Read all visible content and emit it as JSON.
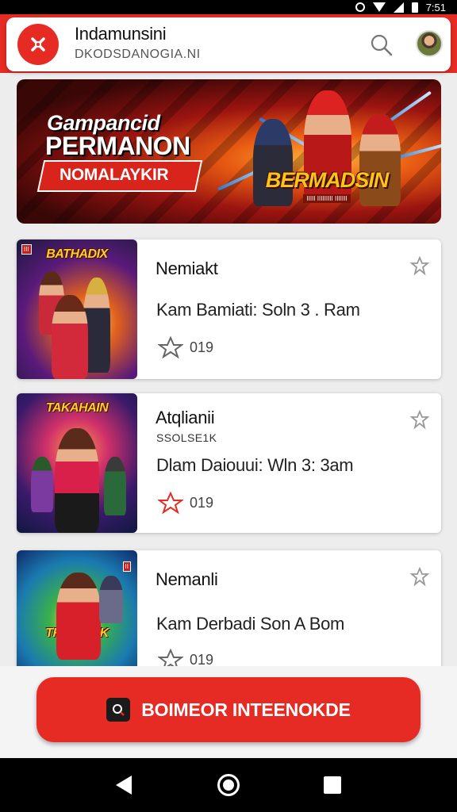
{
  "status_bar": {
    "time": "7:51"
  },
  "header": {
    "title": "Indamunsini",
    "subtitle": "DKODSDANOGIA.NI",
    "logo_icon": "tools-icon",
    "search_icon": "search-icon"
  },
  "banner": {
    "line1": "Gampancid",
    "line2": "PERMANON",
    "tag": "NOMALAYKIR",
    "logo_main": "BERMADSIN",
    "logo_sub": "IIIII IIIIIIIII IIIIIII"
  },
  "games": [
    {
      "thumb_label": "BATHADIX",
      "title": "Nemiakt",
      "subtitle": "",
      "description": "Kam Bamiati: Soln 3 . Ram",
      "rating": "019",
      "star_color": "#666666"
    },
    {
      "thumb_label": "TAKAHAIN",
      "title": "Atqlianii",
      "subtitle": "SSOLSE1K",
      "description": "Dlam Daiouui: Wln 3: 3am",
      "rating": "019",
      "star_color": "#e52b23"
    },
    {
      "thumb_label": "TRNEMIEK",
      "title": "Nemanli",
      "subtitle": "",
      "description": "Kam Derbadi Son A Bom",
      "rating": "019",
      "star_color": "#666666"
    }
  ],
  "cta": {
    "label": "BOIMEOR INTEENOKDE",
    "icon": "search-doc-icon"
  },
  "colors": {
    "accent": "#e52b23",
    "background": "#ededed"
  }
}
